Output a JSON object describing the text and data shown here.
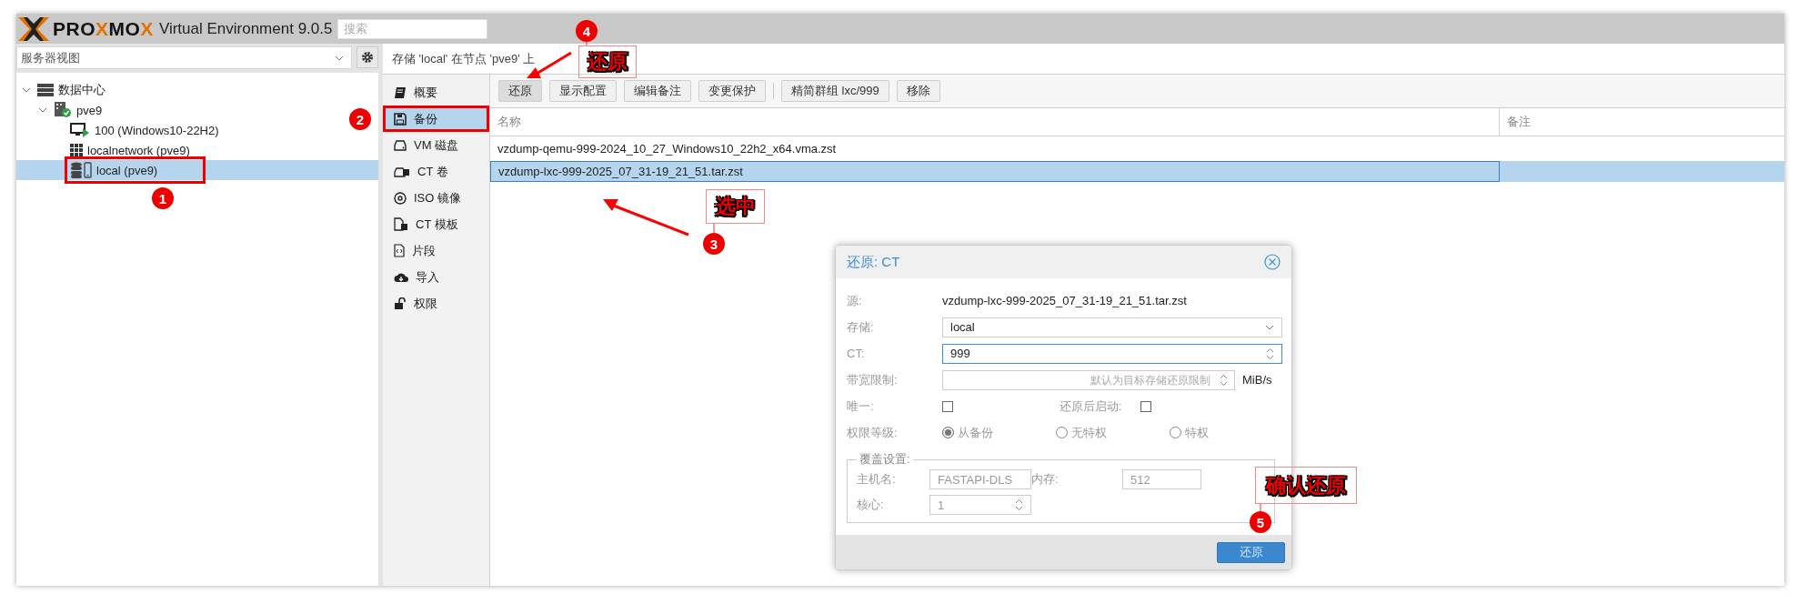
{
  "header": {
    "logo": [
      {
        "text": "PRO",
        "accent": false
      },
      {
        "text": "X",
        "accent": true
      },
      {
        "text": "MO",
        "accent": false
      },
      {
        "text": "X",
        "accent": true
      }
    ],
    "product": "Virtual Environment 9.0.5",
    "search": {
      "placeholder": "搜索"
    }
  },
  "sidebar": {
    "view": "服务器视图",
    "tree": [
      {
        "label": "数据中心",
        "kind": "datacenter",
        "expanded": true,
        "selected": false,
        "highlighted": false,
        "children": [
          {
            "label": "pve9",
            "kind": "node",
            "expanded": true,
            "selected": false,
            "highlighted": false,
            "children": [
              {
                "label": "100 (Windows10-22H2)",
                "kind": "vm",
                "selected": false,
                "highlighted": false
              },
              {
                "label": "localnetwork (pve9)",
                "kind": "network",
                "selected": false,
                "highlighted": false
              },
              {
                "label": "local (pve9)",
                "kind": "storage",
                "selected": true,
                "highlighted": true
              }
            ]
          }
        ]
      }
    ]
  },
  "content": {
    "title": "存储 'local' 在节点 'pve9' 上",
    "nav": [
      {
        "label": "概要",
        "kind": "summary",
        "selected": false,
        "highlighted": false
      },
      {
        "label": "备份",
        "kind": "backup",
        "selected": true,
        "highlighted": true
      },
      {
        "label": "VM 磁盘",
        "kind": "disk",
        "selected": false,
        "highlighted": false
      },
      {
        "label": "CT 卷",
        "kind": "volume",
        "selected": false,
        "highlighted": false
      },
      {
        "label": "ISO 镜像",
        "kind": "iso",
        "selected": false,
        "highlighted": false
      },
      {
        "label": "CT 模板",
        "kind": "template",
        "selected": false,
        "highlighted": false
      },
      {
        "label": "片段",
        "kind": "snippet",
        "selected": false,
        "highlighted": false
      },
      {
        "label": "导入",
        "kind": "import",
        "selected": false,
        "highlighted": false
      },
      {
        "label": "权限",
        "kind": "permissions",
        "selected": false,
        "highlighted": false
      }
    ],
    "toolbar_groups": [
      [
        {
          "label": "还原",
          "pressed": true
        },
        {
          "label": "显示配置",
          "pressed": false
        },
        {
          "label": "编辑备注",
          "pressed": false
        },
        {
          "label": "变更保护",
          "pressed": false
        }
      ],
      [
        {
          "label": "精简群组 lxc/999",
          "pressed": false
        },
        {
          "label": "移除",
          "pressed": false
        }
      ]
    ],
    "table": {
      "columns": [
        "名称",
        "备注"
      ],
      "rows": [
        {
          "name": "vzdump-qemu-999-2024_10_27_Windows10_22h2_x64.vma.zst",
          "selected": false
        },
        {
          "name": "vzdump-lxc-999-2025_07_31-19_21_51.tar.zst",
          "selected": true
        }
      ]
    }
  },
  "dialog": {
    "title": "还原: CT",
    "source_label": "源:",
    "source": "vzdump-lxc-999-2025_07_31-19_21_51.tar.zst",
    "storage_label": "存储:",
    "storage": "local",
    "ct_label": "CT:",
    "ct": "999",
    "ct_focused": true,
    "bandwidth_label": "带宽限制:",
    "bandwidth_placeholder": "默认为目标存储还原限制",
    "bandwidth_unit": "MiB/s",
    "unique_label": "唯一:",
    "unique": false,
    "start_label": "还原后启动:",
    "start": false,
    "privilege_label": "权限等级:",
    "privileges": [
      {
        "label": "从备份",
        "selected": true
      },
      {
        "label": "无特权",
        "selected": false
      },
      {
        "label": "特权",
        "selected": false
      }
    ],
    "override": {
      "legend": "覆盖设置:",
      "hostname_label": "主机名:",
      "hostname": "FASTAPI-DLS",
      "memory_label": "内存:",
      "memory": "512",
      "cores_label": "核心:",
      "cores": "1"
    },
    "button": "还原"
  },
  "annotations": [
    {
      "number": "1"
    },
    {
      "number": "2"
    },
    {
      "number": "3",
      "label": "选中"
    },
    {
      "number": "4",
      "label": "还原"
    },
    {
      "number": "5",
      "label": "确认还原"
    }
  ]
}
